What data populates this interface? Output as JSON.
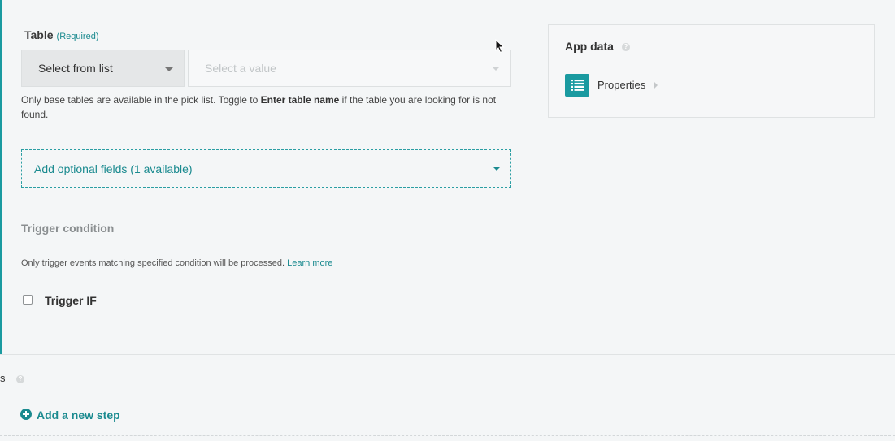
{
  "table_field": {
    "label": "Table",
    "required": "(Required)",
    "mode_select": "Select from list",
    "value_placeholder": "Select a value",
    "help_prefix": "Only base tables are available in the pick list. Toggle to ",
    "help_bold": "Enter table name",
    "help_suffix": " if the table you are looking for is not found."
  },
  "optional_fields": {
    "label": "Add optional fields (1 available)"
  },
  "trigger": {
    "heading": "Trigger condition",
    "help": "Only trigger events matching specified condition will be processed.",
    "learn_more": "Learn more",
    "checkbox_label": "Trigger IF",
    "checked": false
  },
  "app_data": {
    "title": "App data",
    "items": [
      {
        "label": "Properties",
        "icon": "list-icon"
      }
    ]
  },
  "bottom": {
    "partial_label": "s",
    "add_step": "Add a new step"
  },
  "colors": {
    "accent": "#1a9aa0",
    "link": "#1a8a8f",
    "background": "#f4f6f7"
  }
}
